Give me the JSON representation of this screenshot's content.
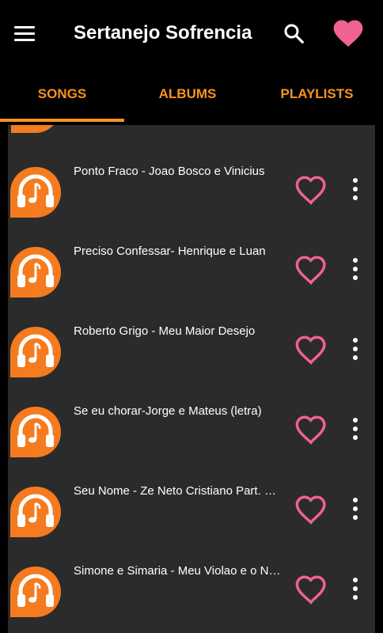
{
  "app": {
    "title": "Sertanejo Sofrencia",
    "icons": {
      "menu": "menu-icon",
      "search": "search-icon",
      "favorites": "heart-filled-icon"
    },
    "colors": {
      "accent": "#f7931e",
      "heart": "#f06292",
      "background": "#000000",
      "list_bg": "#2b2b2b"
    }
  },
  "tabs": [
    {
      "label": "SONGS",
      "selected": true
    },
    {
      "label": "ALBUMS",
      "selected": false
    },
    {
      "label": "PLAYLISTS",
      "selected": false
    }
  ],
  "songs": [
    {
      "title": "Ponto Fraco - Joao Bosco e Vinicius"
    },
    {
      "title": "Preciso Confessar- Henrique e Luan"
    },
    {
      "title": "Roberto Grigo - Meu Maior Desejo"
    },
    {
      "title": "Se eu chorar-Jorge e Mateus (letra)"
    },
    {
      "title": "Seu Nome - Ze Neto  Cristiano Part. Marilia Mendonca"
    },
    {
      "title": "Simone e Simaria - Meu Violao e o Nosso Cachorro"
    }
  ]
}
